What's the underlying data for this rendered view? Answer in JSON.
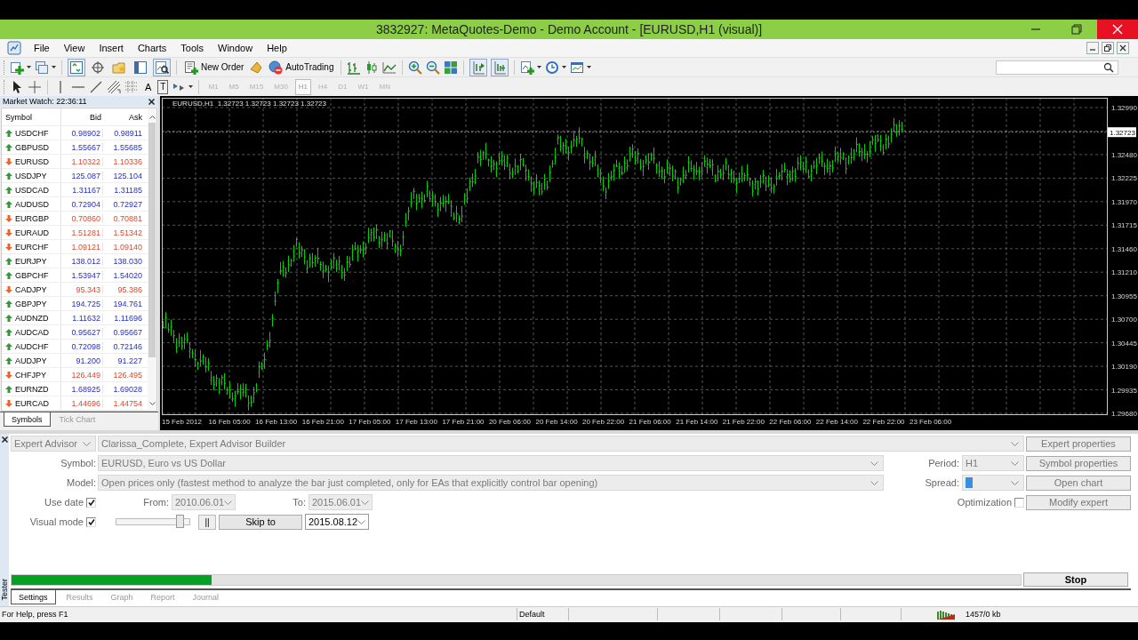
{
  "window": {
    "title": "3832927: MetaQuotes-Demo - Demo Account - [EURUSD,H1 (visual)]"
  },
  "menu": [
    "File",
    "View",
    "Insert",
    "Charts",
    "Tools",
    "Window",
    "Help"
  ],
  "toolbar": {
    "new_order": "New Order",
    "autotrading": "AutoTrading",
    "toggles": {
      "market_watch": true,
      "navigator": false,
      "data_window": false,
      "terminal": false,
      "tester": true,
      "auto_scroll": true,
      "chart_shift": true
    },
    "text_tool": "A",
    "label_tool": "T",
    "periods": [
      {
        "label": "M1",
        "selected": false
      },
      {
        "label": "M5",
        "selected": false
      },
      {
        "label": "M15",
        "selected": false
      },
      {
        "label": "M30",
        "selected": false
      },
      {
        "label": "H1",
        "selected": true
      },
      {
        "label": "H4",
        "selected": false
      },
      {
        "label": "D1",
        "selected": false
      },
      {
        "label": "W1",
        "selected": false
      },
      {
        "label": "MN",
        "selected": false
      }
    ]
  },
  "market_watch": {
    "title": "Market Watch: 22:36:11",
    "columns": [
      "Symbol",
      "Bid",
      "Ask"
    ],
    "rows": [
      {
        "symbol": "USDCHF",
        "rising": true,
        "bid": "0.98902",
        "ask": "0.98911"
      },
      {
        "symbol": "GBPUSD",
        "rising": true,
        "bid": "1.55667",
        "ask": "1.55685"
      },
      {
        "symbol": "EURUSD",
        "rising": false,
        "bid": "1.10322",
        "ask": "1.10336"
      },
      {
        "symbol": "USDJPY",
        "rising": true,
        "bid": "125.087",
        "ask": "125.104"
      },
      {
        "symbol": "USDCAD",
        "rising": true,
        "bid": "1.31167",
        "ask": "1.31185"
      },
      {
        "symbol": "AUDUSD",
        "rising": true,
        "bid": "0.72904",
        "ask": "0.72927"
      },
      {
        "symbol": "EURGBP",
        "rising": false,
        "bid": "0.70860",
        "ask": "0.70881"
      },
      {
        "symbol": "EURAUD",
        "rising": false,
        "bid": "1.51281",
        "ask": "1.51342"
      },
      {
        "symbol": "EURCHF",
        "rising": false,
        "bid": "1.09121",
        "ask": "1.09140"
      },
      {
        "symbol": "EURJPY",
        "rising": true,
        "bid": "138.012",
        "ask": "138.030"
      },
      {
        "symbol": "GBPCHF",
        "rising": true,
        "bid": "1.53947",
        "ask": "1.54020"
      },
      {
        "symbol": "CADJPY",
        "rising": false,
        "bid": "95.343",
        "ask": "95.386"
      },
      {
        "symbol": "GBPJPY",
        "rising": true,
        "bid": "194.725",
        "ask": "194.761"
      },
      {
        "symbol": "AUDNZD",
        "rising": true,
        "bid": "1.11632",
        "ask": "1.11696"
      },
      {
        "symbol": "AUDCAD",
        "rising": true,
        "bid": "0.95627",
        "ask": "0.95667"
      },
      {
        "symbol": "AUDCHF",
        "rising": true,
        "bid": "0.72098",
        "ask": "0.72146"
      },
      {
        "symbol": "AUDJPY",
        "rising": true,
        "bid": "91.200",
        "ask": "91.227"
      },
      {
        "symbol": "CHFJPY",
        "rising": false,
        "bid": "126.449",
        "ask": "126.495"
      },
      {
        "symbol": "EURNZD",
        "rising": true,
        "bid": "1.68925",
        "ask": "1.69028"
      },
      {
        "symbol": "EURCAD",
        "rising": false,
        "bid": "1.44696",
        "ask": "1.44754"
      }
    ],
    "tabs": [
      {
        "label": "Symbols",
        "selected": true
      },
      {
        "label": "Tick Chart",
        "selected": false
      }
    ]
  },
  "chart": {
    "header": "EURUSD,H1  1.32723 1.32723 1.32723 1.32723",
    "current_price": "1.32723",
    "price_labels": [
      "1.32990",
      "1.32480",
      "1.32225",
      "1.31970",
      "1.31715",
      "1.31460",
      "1.31210",
      "1.30955",
      "1.30700",
      "1.30445",
      "1.30190",
      "1.29935",
      "1.29680"
    ],
    "time_labels": [
      "15 Feb 2012",
      "16 Feb 05:00",
      "16 Feb 13:00",
      "16 Feb 21:00",
      "17 Feb 05:00",
      "17 Feb 13:00",
      "17 Feb 21:00",
      "20 Feb 06:00",
      "20 Feb 14:00",
      "20 Feb 22:00",
      "21 Feb 06:00",
      "21 Feb 14:00",
      "21 Feb 22:00",
      "22 Feb 06:00",
      "22 Feb 14:00",
      "22 Feb 22:00",
      "23 Feb 06:00"
    ]
  },
  "tester": {
    "side_label": "Tester",
    "inputs_disabled": true,
    "expert_type": "Expert Advisor",
    "expert": "Clarissa_Complete, Expert Advisor Builder",
    "symbol": {
      "label": "Symbol:",
      "value": "EURUSD, Euro vs US Dollar"
    },
    "model": {
      "label": "Model:",
      "value": "Open prices only (fastest method to analyze the bar just completed, only for EAs that explicitly control bar opening)"
    },
    "period": {
      "label": "Period:",
      "value": "H1"
    },
    "spread": {
      "label": "Spread:",
      "highlighted": true
    },
    "use_date": {
      "label": "Use date",
      "checked": true
    },
    "from": {
      "label": "From:",
      "value": "2010.06.01"
    },
    "to": {
      "label": "To:",
      "value": "2015.06.01"
    },
    "optimization": {
      "label": "Optimization",
      "checked": false
    },
    "visual_mode": {
      "label": "Visual mode",
      "checked": true
    },
    "speed": {
      "level": 0.93
    },
    "pause": "||",
    "skip_button": "Skip to",
    "skip_date": "2015.08.12",
    "buttons": [
      {
        "label": "Expert properties",
        "disabled": true
      },
      {
        "label": "Symbol properties",
        "disabled": true
      },
      {
        "label": "Open chart",
        "disabled": true
      },
      {
        "label": "Modify expert",
        "disabled": true
      }
    ],
    "progress": {
      "level": 0.198
    },
    "stop_button": "Stop",
    "tabs": [
      {
        "label": "Settings",
        "selected": true
      },
      {
        "label": "Results",
        "selected": false
      },
      {
        "label": "Graph",
        "selected": false
      },
      {
        "label": "Report",
        "selected": false
      },
      {
        "label": "Journal",
        "selected": false
      }
    ]
  },
  "status_bar": {
    "help": "For Help, press F1",
    "profile": "Default",
    "traffic": "1457/0 kb"
  }
}
